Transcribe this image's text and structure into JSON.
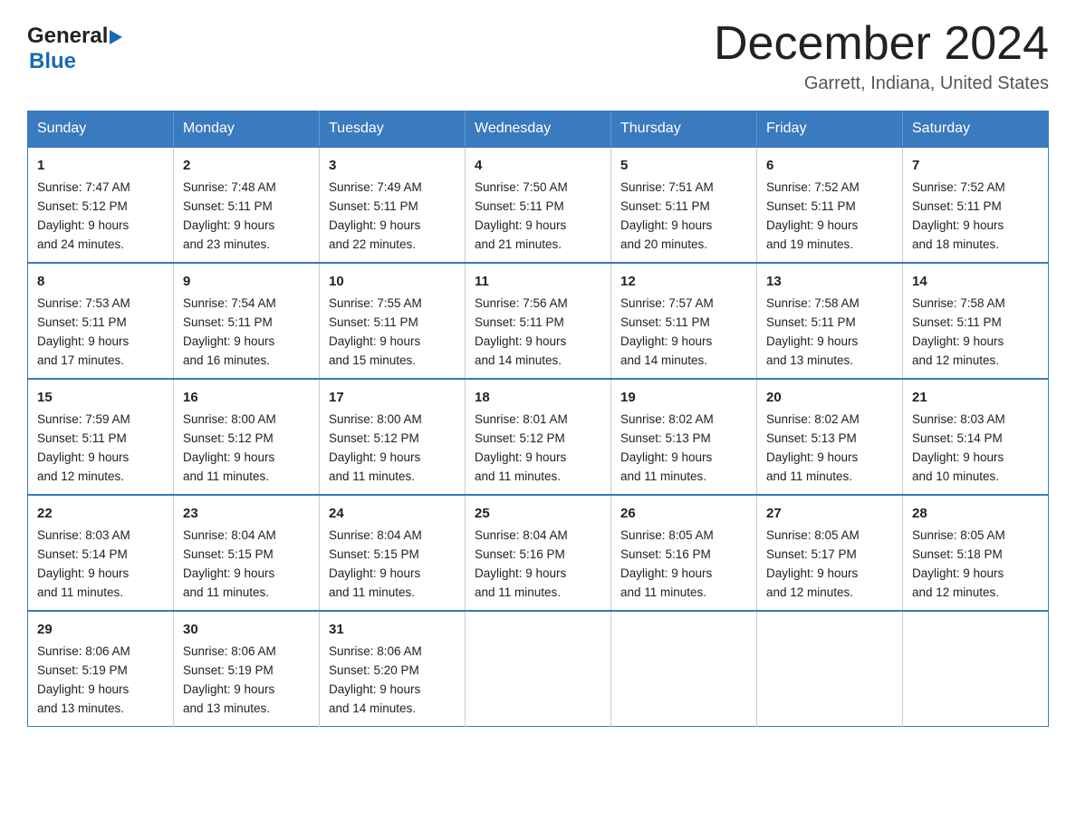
{
  "header": {
    "logo_general": "General",
    "logo_blue": "Blue",
    "month_title": "December 2024",
    "subtitle": "Garrett, Indiana, United States"
  },
  "days_of_week": [
    "Sunday",
    "Monday",
    "Tuesday",
    "Wednesday",
    "Thursday",
    "Friday",
    "Saturday"
  ],
  "weeks": [
    [
      {
        "day": "1",
        "sunrise": "7:47 AM",
        "sunset": "5:12 PM",
        "daylight": "9 hours and 24 minutes."
      },
      {
        "day": "2",
        "sunrise": "7:48 AM",
        "sunset": "5:11 PM",
        "daylight": "9 hours and 23 minutes."
      },
      {
        "day": "3",
        "sunrise": "7:49 AM",
        "sunset": "5:11 PM",
        "daylight": "9 hours and 22 minutes."
      },
      {
        "day": "4",
        "sunrise": "7:50 AM",
        "sunset": "5:11 PM",
        "daylight": "9 hours and 21 minutes."
      },
      {
        "day": "5",
        "sunrise": "7:51 AM",
        "sunset": "5:11 PM",
        "daylight": "9 hours and 20 minutes."
      },
      {
        "day": "6",
        "sunrise": "7:52 AM",
        "sunset": "5:11 PM",
        "daylight": "9 hours and 19 minutes."
      },
      {
        "day": "7",
        "sunrise": "7:52 AM",
        "sunset": "5:11 PM",
        "daylight": "9 hours and 18 minutes."
      }
    ],
    [
      {
        "day": "8",
        "sunrise": "7:53 AM",
        "sunset": "5:11 PM",
        "daylight": "9 hours and 17 minutes."
      },
      {
        "day": "9",
        "sunrise": "7:54 AM",
        "sunset": "5:11 PM",
        "daylight": "9 hours and 16 minutes."
      },
      {
        "day": "10",
        "sunrise": "7:55 AM",
        "sunset": "5:11 PM",
        "daylight": "9 hours and 15 minutes."
      },
      {
        "day": "11",
        "sunrise": "7:56 AM",
        "sunset": "5:11 PM",
        "daylight": "9 hours and 14 minutes."
      },
      {
        "day": "12",
        "sunrise": "7:57 AM",
        "sunset": "5:11 PM",
        "daylight": "9 hours and 14 minutes."
      },
      {
        "day": "13",
        "sunrise": "7:58 AM",
        "sunset": "5:11 PM",
        "daylight": "9 hours and 13 minutes."
      },
      {
        "day": "14",
        "sunrise": "7:58 AM",
        "sunset": "5:11 PM",
        "daylight": "9 hours and 12 minutes."
      }
    ],
    [
      {
        "day": "15",
        "sunrise": "7:59 AM",
        "sunset": "5:11 PM",
        "daylight": "9 hours and 12 minutes."
      },
      {
        "day": "16",
        "sunrise": "8:00 AM",
        "sunset": "5:12 PM",
        "daylight": "9 hours and 11 minutes."
      },
      {
        "day": "17",
        "sunrise": "8:00 AM",
        "sunset": "5:12 PM",
        "daylight": "9 hours and 11 minutes."
      },
      {
        "day": "18",
        "sunrise": "8:01 AM",
        "sunset": "5:12 PM",
        "daylight": "9 hours and 11 minutes."
      },
      {
        "day": "19",
        "sunrise": "8:02 AM",
        "sunset": "5:13 PM",
        "daylight": "9 hours and 11 minutes."
      },
      {
        "day": "20",
        "sunrise": "8:02 AM",
        "sunset": "5:13 PM",
        "daylight": "9 hours and 11 minutes."
      },
      {
        "day": "21",
        "sunrise": "8:03 AM",
        "sunset": "5:14 PM",
        "daylight": "9 hours and 10 minutes."
      }
    ],
    [
      {
        "day": "22",
        "sunrise": "8:03 AM",
        "sunset": "5:14 PM",
        "daylight": "9 hours and 11 minutes."
      },
      {
        "day": "23",
        "sunrise": "8:04 AM",
        "sunset": "5:15 PM",
        "daylight": "9 hours and 11 minutes."
      },
      {
        "day": "24",
        "sunrise": "8:04 AM",
        "sunset": "5:15 PM",
        "daylight": "9 hours and 11 minutes."
      },
      {
        "day": "25",
        "sunrise": "8:04 AM",
        "sunset": "5:16 PM",
        "daylight": "9 hours and 11 minutes."
      },
      {
        "day": "26",
        "sunrise": "8:05 AM",
        "sunset": "5:16 PM",
        "daylight": "9 hours and 11 minutes."
      },
      {
        "day": "27",
        "sunrise": "8:05 AM",
        "sunset": "5:17 PM",
        "daylight": "9 hours and 12 minutes."
      },
      {
        "day": "28",
        "sunrise": "8:05 AM",
        "sunset": "5:18 PM",
        "daylight": "9 hours and 12 minutes."
      }
    ],
    [
      {
        "day": "29",
        "sunrise": "8:06 AM",
        "sunset": "5:19 PM",
        "daylight": "9 hours and 13 minutes."
      },
      {
        "day": "30",
        "sunrise": "8:06 AM",
        "sunset": "5:19 PM",
        "daylight": "9 hours and 13 minutes."
      },
      {
        "day": "31",
        "sunrise": "8:06 AM",
        "sunset": "5:20 PM",
        "daylight": "9 hours and 14 minutes."
      },
      null,
      null,
      null,
      null
    ]
  ],
  "labels": {
    "sunrise": "Sunrise:",
    "sunset": "Sunset:",
    "daylight": "Daylight:"
  },
  "colors": {
    "header_bg": "#3a7abf",
    "border": "#3a7abf"
  }
}
